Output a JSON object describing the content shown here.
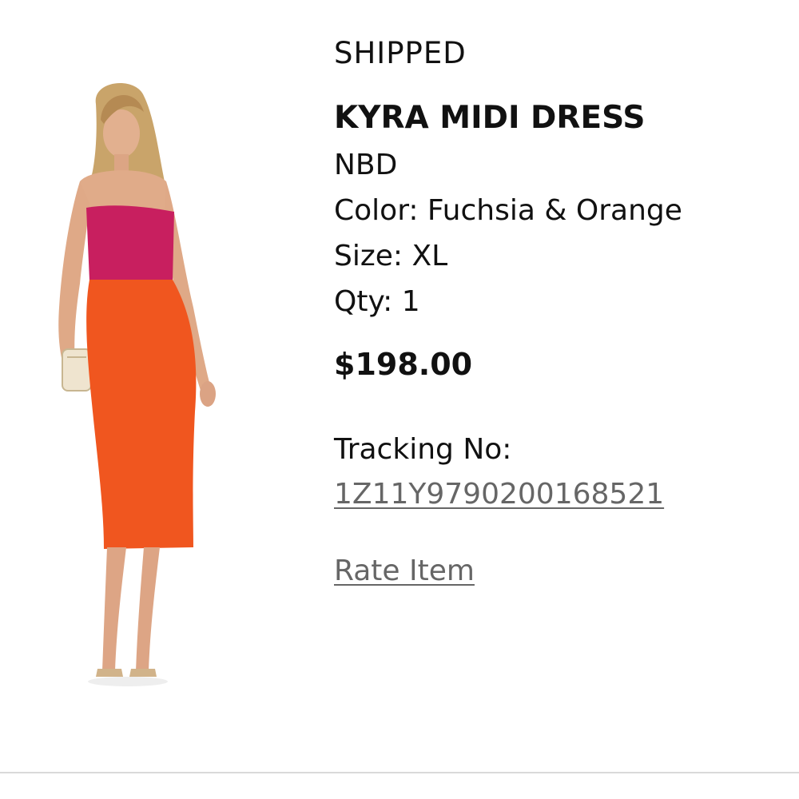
{
  "order_item": {
    "status": "SHIPPED",
    "product_name": "KYRA MIDI DRESS",
    "brand": "NBD",
    "color": "Color: Fuchsia & Orange",
    "size": "Size: XL",
    "qty": "Qty: 1",
    "price": "$198.00",
    "tracking_label": "Tracking No:",
    "tracking_number": "1Z11Y9790200168521",
    "rate_link": "Rate Item"
  },
  "colors": {
    "fuchsia": "#c81f5f",
    "orange": "#f0561f",
    "link_gray": "#666666",
    "divider": "#d9d9d9"
  }
}
